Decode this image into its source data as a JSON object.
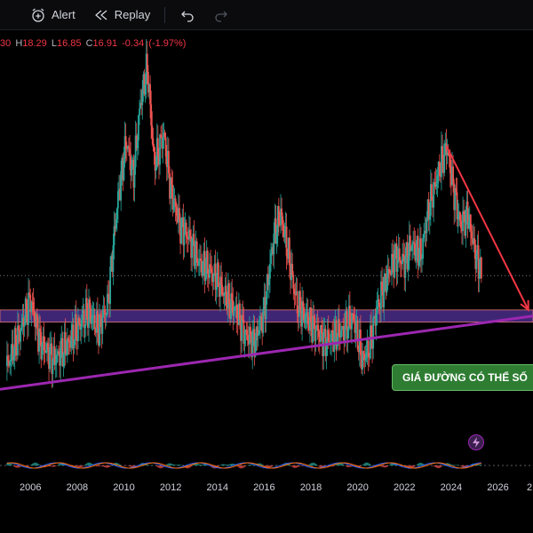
{
  "toolbar": {
    "alert_label": "Alert",
    "replay_label": "Replay",
    "alert_icon": "alarm-clock-plus-icon",
    "replay_icon": "rewind-icon",
    "undo_icon": "undo-icon",
    "redo_icon": "redo-icon"
  },
  "legend": {
    "open_value": "30",
    "high_label": "H",
    "high_value": "18.29",
    "low_label": "L",
    "low_value": "16.85",
    "close_label": "C",
    "close_value": "16.91",
    "change_value": "-0.34",
    "change_percent": "(-1.97%)"
  },
  "annotation": {
    "text": "GIÁ ĐƯỜNG CÓ THỂ SỐ",
    "color": "#2e7d32"
  },
  "colors": {
    "background": "#000000",
    "up": "#26a69a",
    "down": "#ef5350",
    "support_zone": "#4a2d8a",
    "trendline": "#9c27b0",
    "projection_arrow": "#f23645",
    "dotted_level": "#787b86"
  },
  "chart_data": {
    "type": "line",
    "x_axis_ticks": [
      "2006",
      "2008",
      "2010",
      "2012",
      "2014",
      "2016",
      "2018",
      "2020",
      "2022",
      "2024",
      "2026",
      "2"
    ],
    "series": [
      {
        "x": [
          2005.0,
          2005.5,
          2006.0,
          2006.4,
          2007.0,
          2007.5,
          2008.0,
          2008.5,
          2008.9,
          2009.3,
          2009.7,
          2010.1,
          2010.4,
          2010.7,
          2011.0,
          2011.3,
          2011.7,
          2012.0,
          2012.4,
          2012.8,
          2013.2,
          2013.6,
          2014.0,
          2014.4,
          2014.8,
          2015.2,
          2015.6,
          2016.0,
          2016.4,
          2016.7,
          2017.0,
          2017.4,
          2017.8,
          2018.2,
          2018.6,
          2019.0,
          2019.4,
          2019.8,
          2020.2,
          2020.5,
          2020.8,
          2021.2,
          2021.6,
          2022.0,
          2022.3,
          2022.7,
          2023.0,
          2023.4,
          2023.8,
          2024.1,
          2024.4,
          2024.7,
          2025.0,
          2025.3
        ],
        "values": [
          9.5,
          12.0,
          15.0,
          11.5,
          10.0,
          11.0,
          12.5,
          14.0,
          12.5,
          14.5,
          22.5,
          28.0,
          25.0,
          31.0,
          34.0,
          26.0,
          28.5,
          24.0,
          21.0,
          20.0,
          18.0,
          17.5,
          16.5,
          15.0,
          14.0,
          12.0,
          11.5,
          14.0,
          20.0,
          22.0,
          19.0,
          14.5,
          13.5,
          12.5,
          11.5,
          12.0,
          12.5,
          13.5,
          10.0,
          11.0,
          14.0,
          16.5,
          18.5,
          18.0,
          19.5,
          18.5,
          22.0,
          25.0,
          27.5,
          24.0,
          21.0,
          22.0,
          19.0,
          16.91
        ]
      }
    ],
    "support_zone": [
      13.1,
      14.1
    ],
    "trendline": {
      "start": [
        2004.7,
        7.6
      ],
      "end": [
        2027.5,
        13.6
      ]
    },
    "projection": {
      "start": [
        2023.8,
        27.5
      ],
      "end": [
        2027.3,
        14.1
      ]
    },
    "ylim": [
      5,
      37
    ],
    "xlim": [
      2004.7,
      2027.5
    ]
  }
}
